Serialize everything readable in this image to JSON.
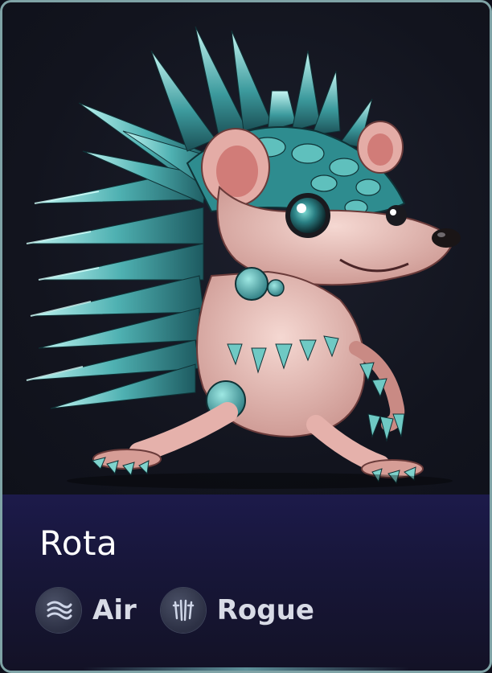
{
  "card": {
    "name": "Rota",
    "tags": [
      {
        "label": "Air",
        "icon": "air-wind-icon"
      },
      {
        "label": "Rogue",
        "icon": "rogue-claws-icon"
      }
    ]
  },
  "colors": {
    "spike": "#3fa6a8",
    "spike_light": "#9fe6e4",
    "body": "#e9c2bd",
    "info_panel": "#1c1a4a",
    "border": "#7fa3a6"
  }
}
